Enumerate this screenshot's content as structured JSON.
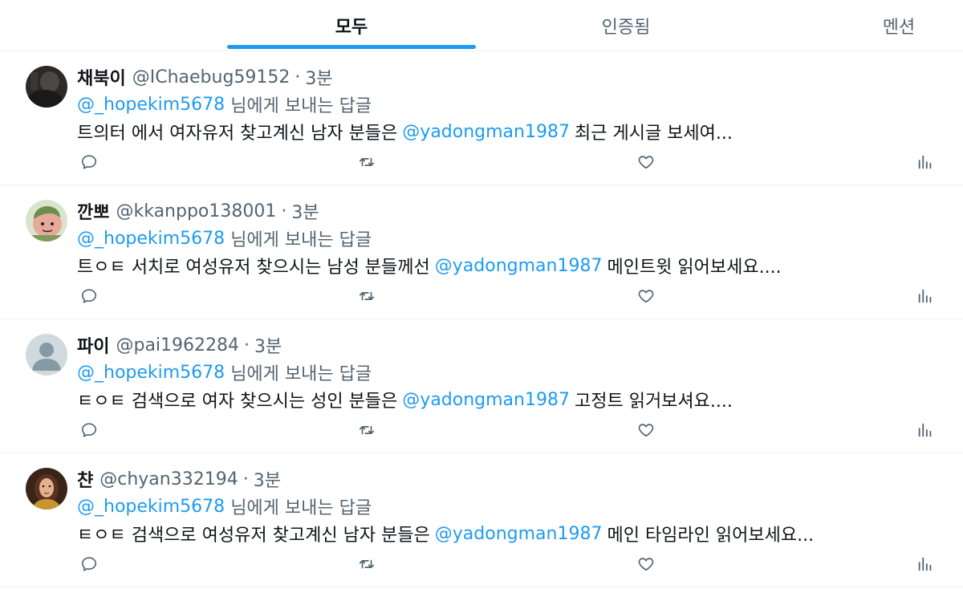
{
  "tabs": [
    {
      "label": "모두",
      "active": true
    },
    {
      "label": "인증됨",
      "active": false
    },
    {
      "label": "멘션",
      "active": false
    }
  ],
  "tweets": [
    {
      "name": "채북이",
      "handle": "@IChaebug59152",
      "sep": "·",
      "time": "3분",
      "reply_to": "@_hopekim5678",
      "reply_suffix": "님에게 보내는 답글",
      "text_before": "트의터 에서 여자유저 찾고계신 남자 분들은",
      "text_link": "@yadongman1987",
      "text_after": "최근 게시글 보세여...",
      "avatar": "dark-photo-avatar"
    },
    {
      "name": "깐뽀",
      "handle": "@kkanppo138001",
      "sep": "·",
      "time": "3분",
      "reply_to": "@_hopekim5678",
      "reply_suffix": "님에게 보내는 답글",
      "text_before": "트ㅇㅌ 서치로 여성유저 찾으시는 남성 분들께선",
      "text_link": "@yadongman1987",
      "text_after": "메인트윗 읽어보세요....",
      "avatar": "cartoon-avatar"
    },
    {
      "name": "파이",
      "handle": "@pai1962284",
      "sep": "·",
      "time": "3분",
      "reply_to": "@_hopekim5678",
      "reply_suffix": "님에게 보내는 답글",
      "text_before": "ㅌㅇㅌ 검색으로 여자 찾으시는 성인 분들은",
      "text_link": "@yadongman1987",
      "text_after": "고정트 읽거보셔요....",
      "avatar": "default-avatar"
    },
    {
      "name": "챤",
      "handle": "@chyan332194",
      "sep": "·",
      "time": "3분",
      "reply_to": "@_hopekim5678",
      "reply_suffix": "님에게 보내는 답글",
      "text_before": "ㅌㅇㅌ 검색으로 여성유저 찾고계신 남자 분들은",
      "text_link": "@yadongman1987",
      "text_after": "메인 타임라인 읽어보세요...",
      "avatar": "woman-photo-avatar"
    }
  ],
  "colors": {
    "accent": "#1d9bf0",
    "text": "#0f1419",
    "secondary": "#536471",
    "divider": "#eff3f4"
  }
}
